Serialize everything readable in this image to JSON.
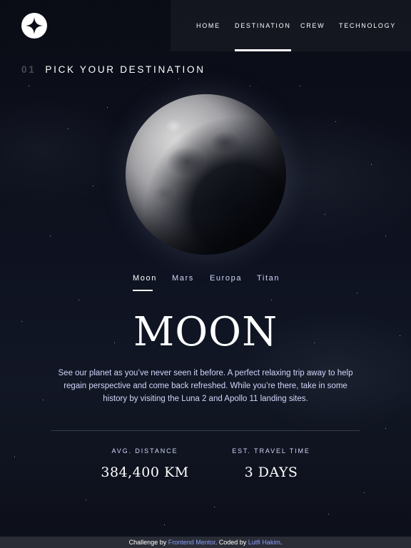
{
  "nav": {
    "items": [
      {
        "label": "Home",
        "active": false
      },
      {
        "label": "Destination",
        "active": true
      },
      {
        "label": "Crew",
        "active": false
      },
      {
        "label": "Technology",
        "active": false
      }
    ]
  },
  "heading": {
    "number": "01",
    "title": "Pick your destination"
  },
  "tabs": [
    {
      "label": "Moon",
      "active": true
    },
    {
      "label": "Mars",
      "active": false
    },
    {
      "label": "Europa",
      "active": false
    },
    {
      "label": "Titan",
      "active": false
    }
  ],
  "destination": {
    "name": "MOON",
    "description": "See our planet as you’ve never seen it before. A perfect relaxing trip away to help regain perspective and come back refreshed. While you’re there, take in some history by visiting the Luna 2 and Apollo 11 landing sites.",
    "stats": {
      "distance_label": "Avg. distance",
      "distance_value": "384,400 km",
      "travel_label": "Est. travel time",
      "travel_value": "3 days"
    }
  },
  "footer": {
    "prefix": "Challenge by ",
    "link1": "Frontend Mentor",
    "middle": ". Coded by ",
    "link2": "Lutfi Hakim",
    "suffix": "."
  },
  "colors": {
    "background": "#0b0d17",
    "text_secondary": "#d0d6f9",
    "link": "#8c9eff"
  },
  "icons": {
    "logo": "four-point-star-icon"
  }
}
